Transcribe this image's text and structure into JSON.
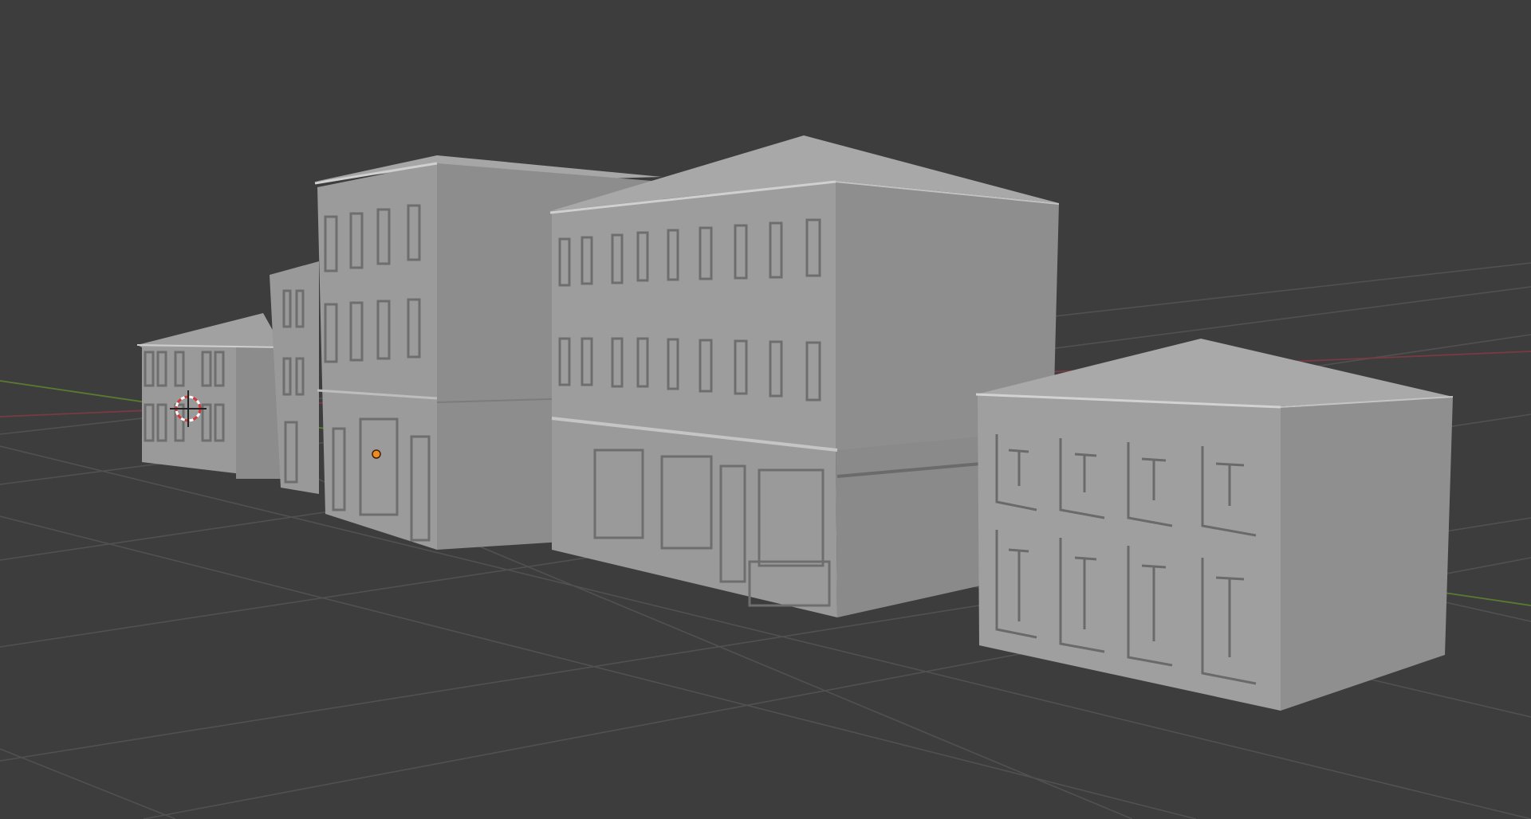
{
  "app": {
    "background_color": "#3d3d3d",
    "grid_color": "#515151",
    "x_axis_color": "#8a3b44",
    "y_axis_color": "#5a7a32",
    "model_color_light": "#a5a5a5",
    "model_color_mid": "#979797",
    "model_color_dark": "#8e8e8e",
    "origin_color": "#f08a24",
    "cursor_color": "#d23a3a"
  },
  "viewport": {
    "name": "3d-viewport",
    "objects": [
      "building-small-left",
      "building-tall-center",
      "building-corner-shop",
      "building-small-right"
    ],
    "icons": [
      "3d-cursor-icon",
      "object-origin-icon"
    ]
  }
}
